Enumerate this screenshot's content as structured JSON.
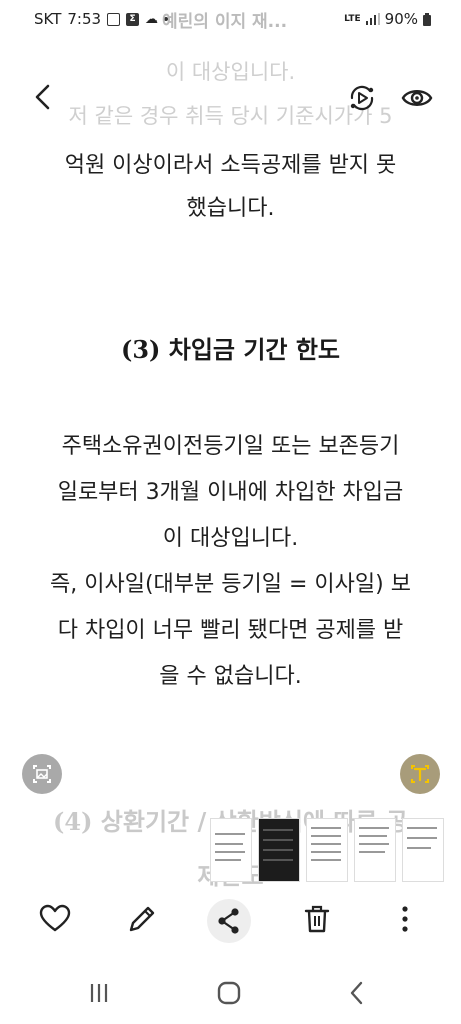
{
  "status_bar": {
    "carrier": "SKT",
    "time": "7:53",
    "network": "LTE",
    "battery": "90%"
  },
  "background_title": "예린의 이지 재...",
  "ghost_lines": [
    "이 대상입니다.",
    "저 같은 경우 취득 당시 기준시가가 5"
  ],
  "article": {
    "intro_lines": [
      "억원 이상이라서 소득공제를 받지 못",
      "했습니다."
    ],
    "heading": "(3) 차입금 기간 한도",
    "body_lines": [
      "주택소유권이전등기일 또는 보존등기",
      "일로부터 3개월 이내에 차입한 차입금",
      "이 대상입니다.",
      "즉, 이사일(대부분 등기일 = 이사일) 보",
      "다 차입이 너무 빨리 됐다면 공제를 받",
      "을 수 없습니다."
    ],
    "next_heading": "(4) 상환기간 / 상환방식에 따른 공",
    "next_heading_line2": "제한도"
  },
  "icons": {
    "back": "back-chevron-icon",
    "play": "rotate-play-icon",
    "eye": "eye-icon",
    "image": "image-icon",
    "text_recognize": "text-recognize-icon",
    "heart": "heart-icon",
    "edit": "pencil-icon",
    "share": "share-icon",
    "delete": "trash-icon",
    "more": "more-vertical-icon"
  },
  "colors": {
    "accent_yellow": "#f5c400",
    "text": "#1f1f1f"
  }
}
